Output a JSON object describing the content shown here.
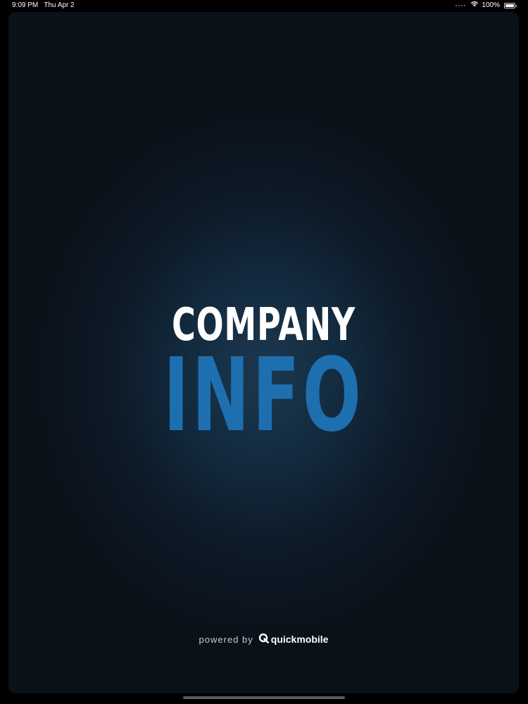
{
  "status_bar": {
    "time": "9:09 PM",
    "date": "Thu Apr 2",
    "battery": "100%"
  },
  "splash": {
    "title_line1": "COMPANY",
    "title_line2": "INFO",
    "powered_by": "powered by",
    "brand": "quickmobile"
  },
  "colors": {
    "title_line1": "#ffffff",
    "title_line2": "#1e6fb0",
    "background": "#0b1119"
  }
}
